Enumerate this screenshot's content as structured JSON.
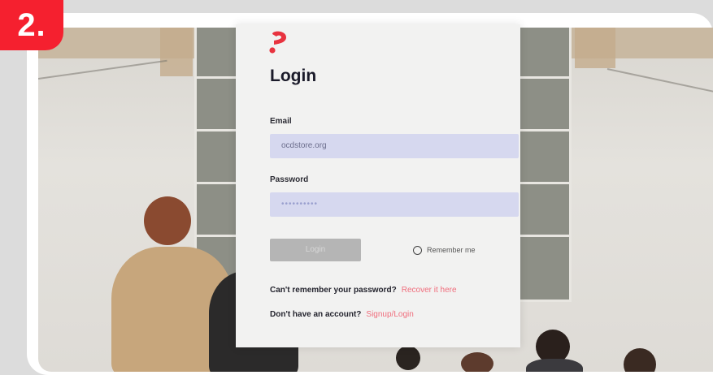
{
  "step_badge": "2.",
  "login_card": {
    "title": "Login",
    "email_label": "Email",
    "email_value": "ocdstore.org",
    "password_label": "Password",
    "password_value": "••••••••••",
    "login_button": "Login",
    "remember_label": "Remember me",
    "forgot_text": "Can't remember your password?",
    "forgot_link": "Recover it here",
    "signup_text": "Don't have an account?",
    "signup_link": "Signup/Login"
  },
  "colors": {
    "badge": "#f5202f",
    "accent": "#e8333f",
    "input_bg": "#d6d8ef",
    "link": "#f06d7c"
  }
}
